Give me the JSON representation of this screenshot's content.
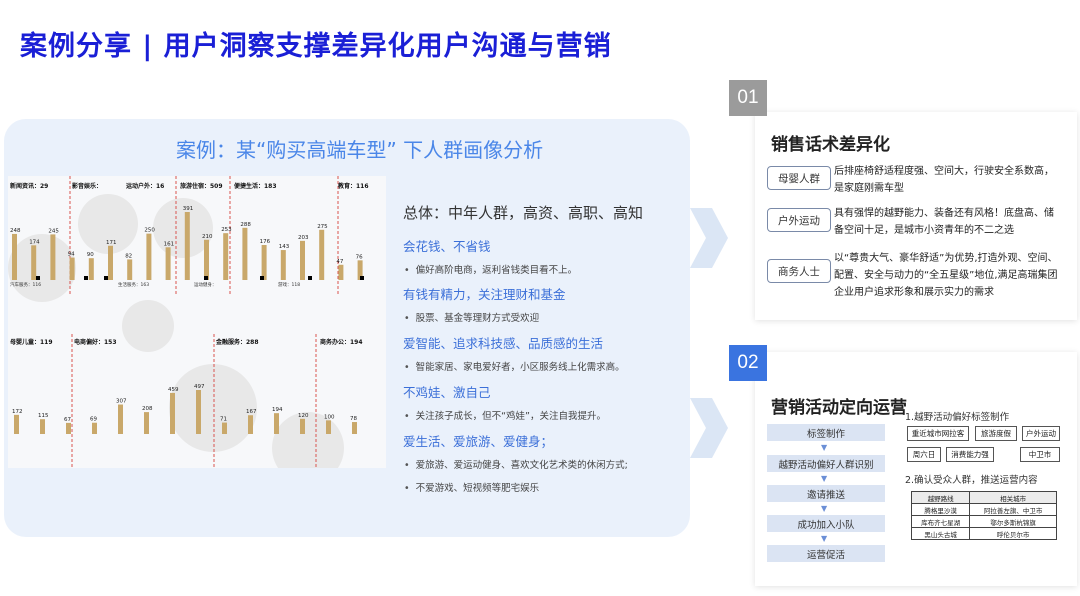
{
  "title": "案例分享 | 用户洞察支撑差异化用户沟通与营销",
  "case": {
    "title": "案例：某“购买高端车型” 下人群画像分析",
    "overall": "总体：中年人群，高资、高职、高知",
    "sections": [
      {
        "heading": "会花钱、不省钱",
        "bullets": [
          "偏好高阶电商，返利省钱类目看不上。"
        ]
      },
      {
        "heading": "有钱有精力，关注理财和基金",
        "bullets": [
          "股票、基金等理财方式受欢迎"
        ]
      },
      {
        "heading": "爱智能、追求科技感、品质感的生活",
        "bullets": [
          "智能家居、家电爱好者，小区服务线上化需求高。"
        ]
      },
      {
        "heading": "不鸡娃、激自己",
        "bullets": [
          "关注孩子成长，但不“鸡娃”，关注自我提升。"
        ]
      },
      {
        "heading": "爱生活、爱旅游、爱健身；",
        "bullets": [
          "爱旅游、爱运动健身、喜欢文化艺术类的休闲方式;",
          "不爱游戏、短视频等肥宅娱乐"
        ]
      }
    ],
    "top_labels": [
      "新闻资讯：29",
      "影音娱乐：",
      "运动户外：16",
      "旅游住宿：509",
      "便捷生活：183",
      "教育：116"
    ],
    "top_values": [
      "248",
      "174",
      "245",
      "94",
      "90",
      "171",
      "82",
      "250",
      "161",
      "391",
      "210",
      "253",
      "288",
      "176",
      "143",
      "203",
      "275",
      "47",
      "76"
    ],
    "bottom_labels": [
      "母婴儿童：119",
      "电商偏好：153",
      "金融服务：288",
      "商务办公：194"
    ],
    "bottom_values": [
      "172",
      "115",
      "67",
      "69",
      "307",
      "208",
      "459",
      "497",
      "71",
      "167",
      "194",
      "120",
      "100",
      "78"
    ],
    "mid_labels": [
      "汽车服务：116",
      "生活服务：163",
      "运动健身：",
      "游戏：118"
    ]
  },
  "card1": {
    "number": "01",
    "title": "销售话术差异化",
    "rows": [
      {
        "tag": "母婴人群",
        "desc": "后排座椅舒适程度强、空间大，行驶安全系数高，是家庭刚需车型"
      },
      {
        "tag": "户外运动",
        "desc": "具有强悍的越野能力、装备还有风格！底盘高、储备空间十足，是城市小资青年的不二之选"
      },
      {
        "tag": "商务人士",
        "desc": "以“尊贵大气、豪华舒适”为优势,打造外观、空间、配置、安全与动力的“全五星级”地位,满足高瑞集团企业用户追求形象和展示实力的需求"
      }
    ]
  },
  "card2": {
    "number": "02",
    "title": "营销活动定向运营",
    "steps": [
      "标签制作",
      "越野活动偏好人群识别",
      "邀请推送",
      "成功加入小队",
      "运营促活"
    ],
    "step1_label": "1.越野活动偏好标签制作",
    "chips": [
      "重近城市网拉客",
      "旅游度假",
      "户外运动",
      "周六日",
      "消费能力强",
      "中卫市"
    ],
    "step2_label": "2.确认受众人群，推送运营内容",
    "table_headers": [
      "越野路线",
      "相关城市"
    ],
    "table_rows": [
      [
        "腾格里沙漠",
        "阿拉善左旗、中卫市"
      ],
      [
        "库布齐七星湖",
        "鄂尔多斯杭锦旗"
      ],
      [
        "黑山头古城",
        "呼伦贝尔市"
      ]
    ]
  },
  "colors": {
    "accent": "#1a1fd6",
    "badge": "#9b9b9b",
    "badge_blue": "#3a74e0",
    "bar": "#c9a86a"
  }
}
